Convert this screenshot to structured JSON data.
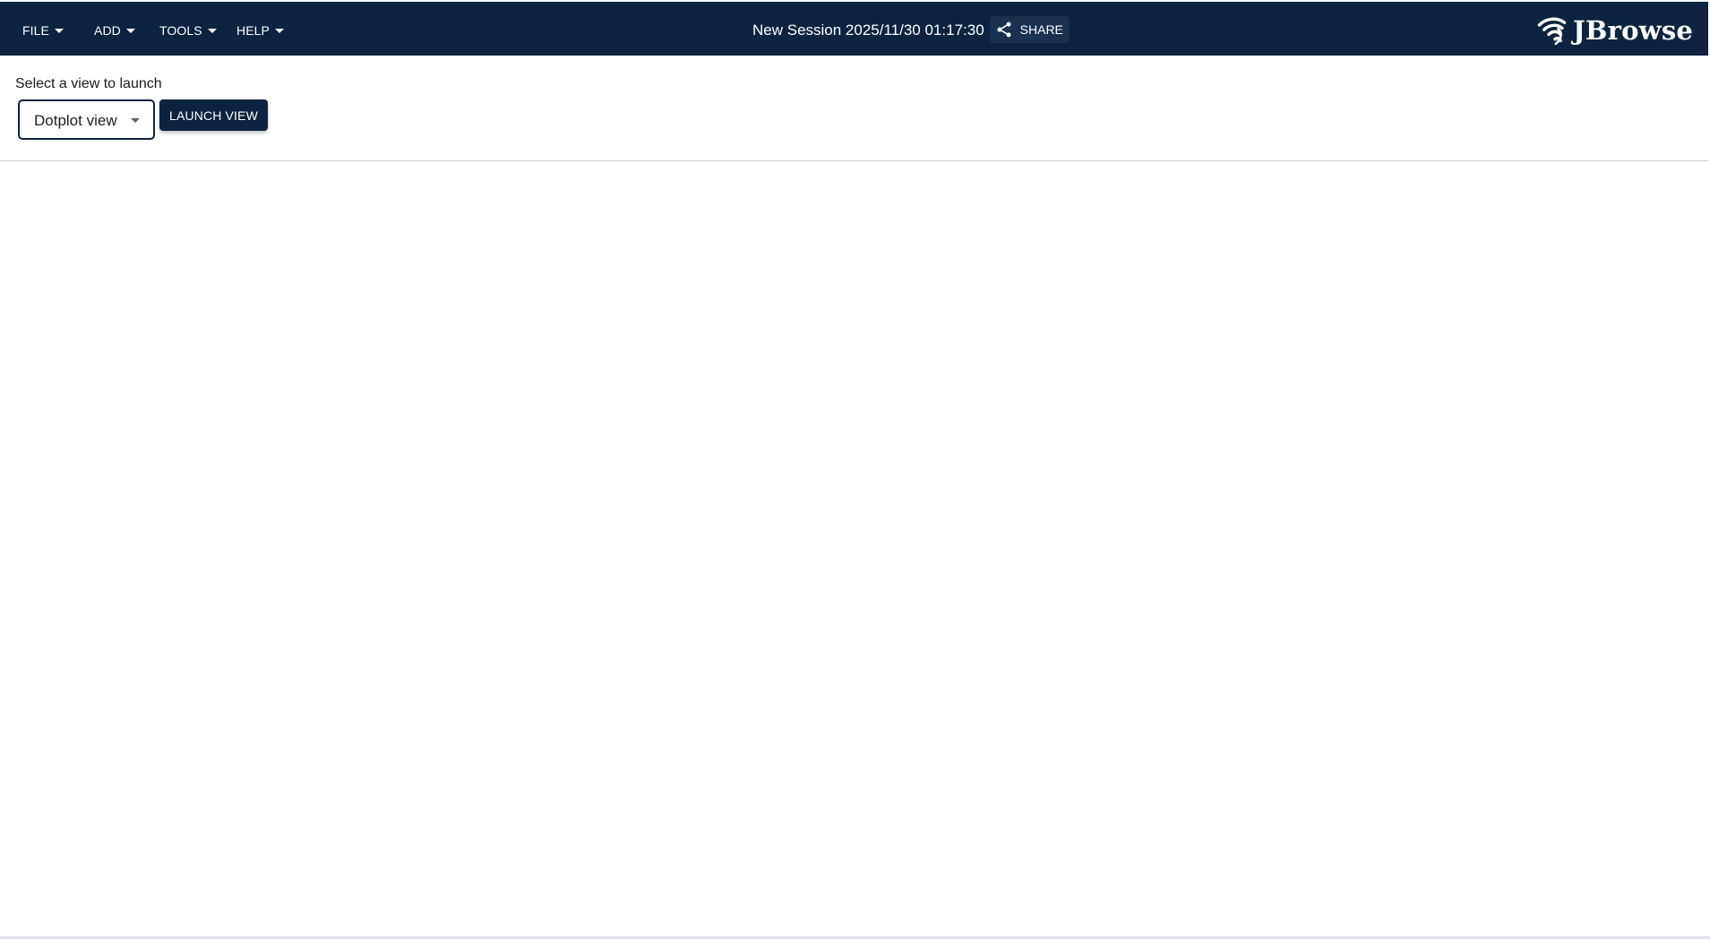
{
  "app": {
    "name": "JBrowse"
  },
  "header": {
    "menus": [
      {
        "label": "FILE",
        "icon": "chevron-down-icon"
      },
      {
        "label": "ADD",
        "icon": "chevron-down-icon"
      },
      {
        "label": "TOOLS",
        "icon": "chevron-down-icon"
      },
      {
        "label": "HELP",
        "icon": "chevron-down-icon"
      }
    ],
    "session_name": "New Session 2025/11/30 01:17:30",
    "share": {
      "label": "SHARE",
      "icon": "share-icon"
    },
    "logo_text": "JBrowse"
  },
  "view_launcher": {
    "label": "Select a view to launch",
    "selected_view": "Dotplot view",
    "launch_label": "LAUNCH VIEW"
  },
  "colors": {
    "appbar_background": "#0d233f",
    "launch_button_background": "#0d233f",
    "select_border": "#0d233f",
    "page_background": "#ffffff"
  }
}
